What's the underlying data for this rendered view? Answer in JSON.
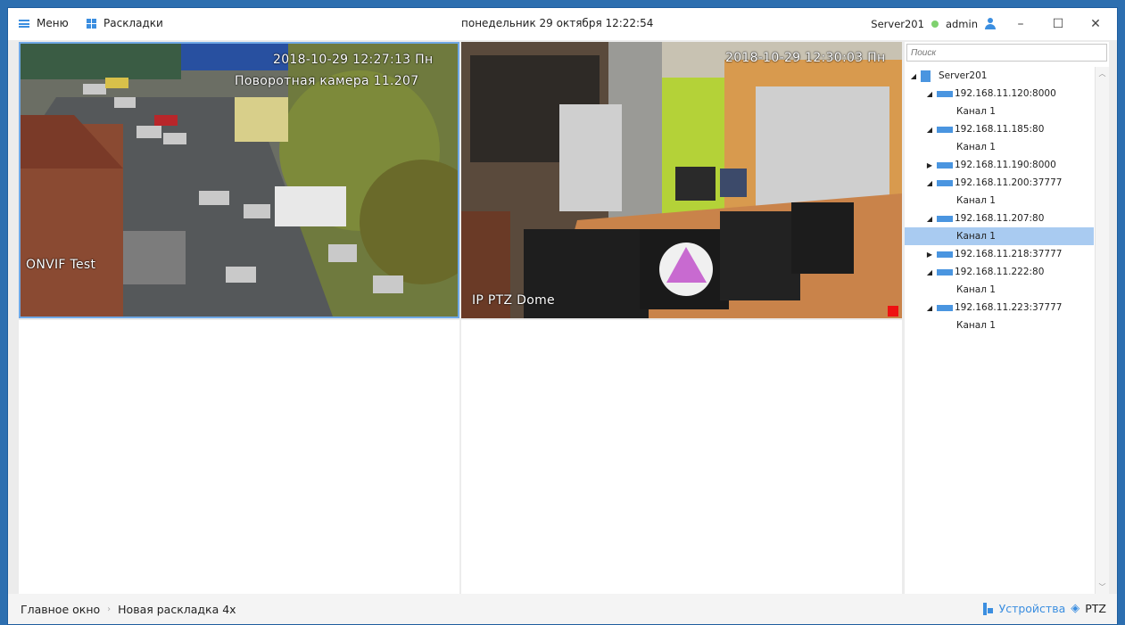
{
  "titlebar": {
    "menu_label": "Меню",
    "layouts_label": "Раскладки",
    "datetime": "понедельник 29 октября 12:22:54",
    "server": "Server201",
    "user": "admin",
    "minimize": "–",
    "maximize": "☐",
    "close": "✕"
  },
  "cameras": [
    {
      "timestamp": "2018-10-29 12:27:13 Пн",
      "title": "Поворотная камера 11.207",
      "name": "ONVIF Test"
    },
    {
      "timestamp": "2018-10-29 12:30:03 Пн",
      "name": "IP PTZ Dome"
    }
  ],
  "search": {
    "placeholder": "Поиск"
  },
  "tree": {
    "root": "Server201",
    "devices": [
      {
        "label": "192.168.11.120:8000",
        "channel": "Канал 1"
      },
      {
        "label": "192.168.11.185:80",
        "channel": "Канал 1"
      },
      {
        "label": "192.168.11.190:8000"
      },
      {
        "label": "192.168.11.200:37777",
        "channel": "Канал 1"
      },
      {
        "label": "192.168.11.207:80",
        "channel": "Канал 1"
      },
      {
        "label": "192.168.11.218:37777"
      },
      {
        "label": "192.168.11.222:80",
        "channel": "Канал 1"
      },
      {
        "label": "192.168.11.223:37777",
        "channel": "Канал 1"
      }
    ]
  },
  "statusbar": {
    "crumb_main": "Главное окно",
    "crumb_sep": "›",
    "crumb_layout": "Новая раскладка 4x",
    "devices_label": "Устройства",
    "ptz_label": "PTZ"
  },
  "colors": {
    "accent": "#3b8ee0",
    "selection": "#a9cbf1",
    "online": "#7fd16f",
    "recording": "#ee1111"
  }
}
